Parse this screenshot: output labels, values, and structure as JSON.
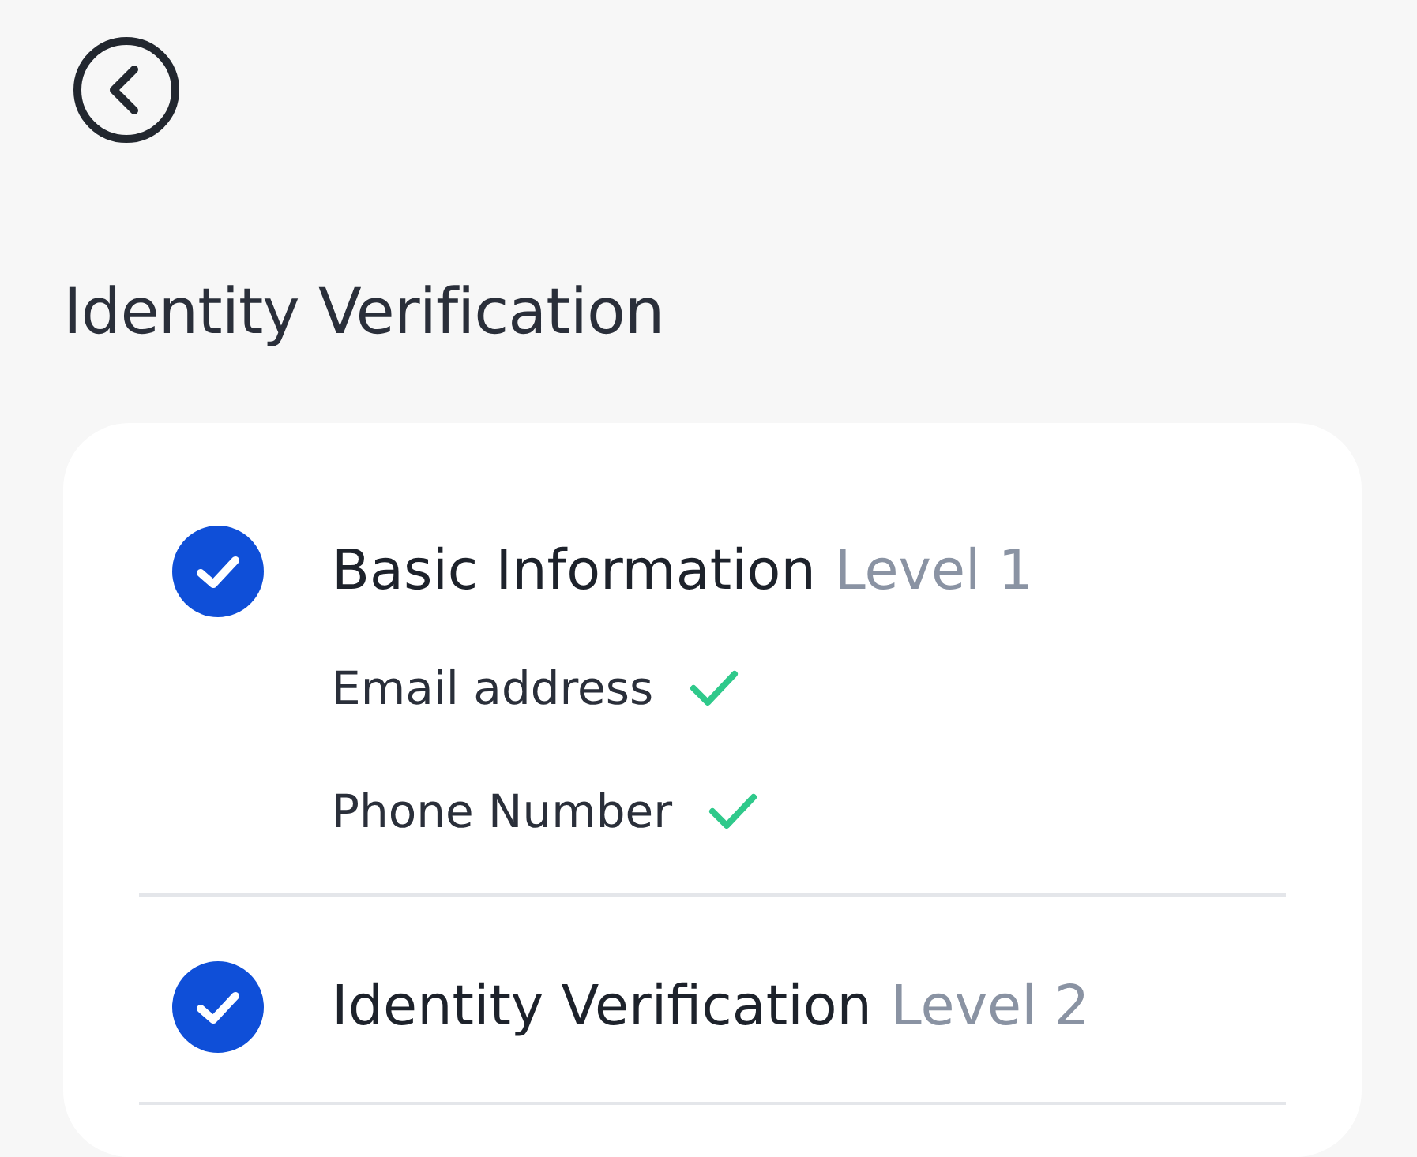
{
  "title": "Identity Verification",
  "levels": [
    {
      "name": "Basic Information",
      "level": "Level 1",
      "completed": true,
      "items": [
        {
          "label": "Email address",
          "verified": true
        },
        {
          "label": "Phone Number",
          "verified": true
        }
      ]
    },
    {
      "name": "Identity Verification",
      "level": "Level 2",
      "completed": true
    }
  ]
}
